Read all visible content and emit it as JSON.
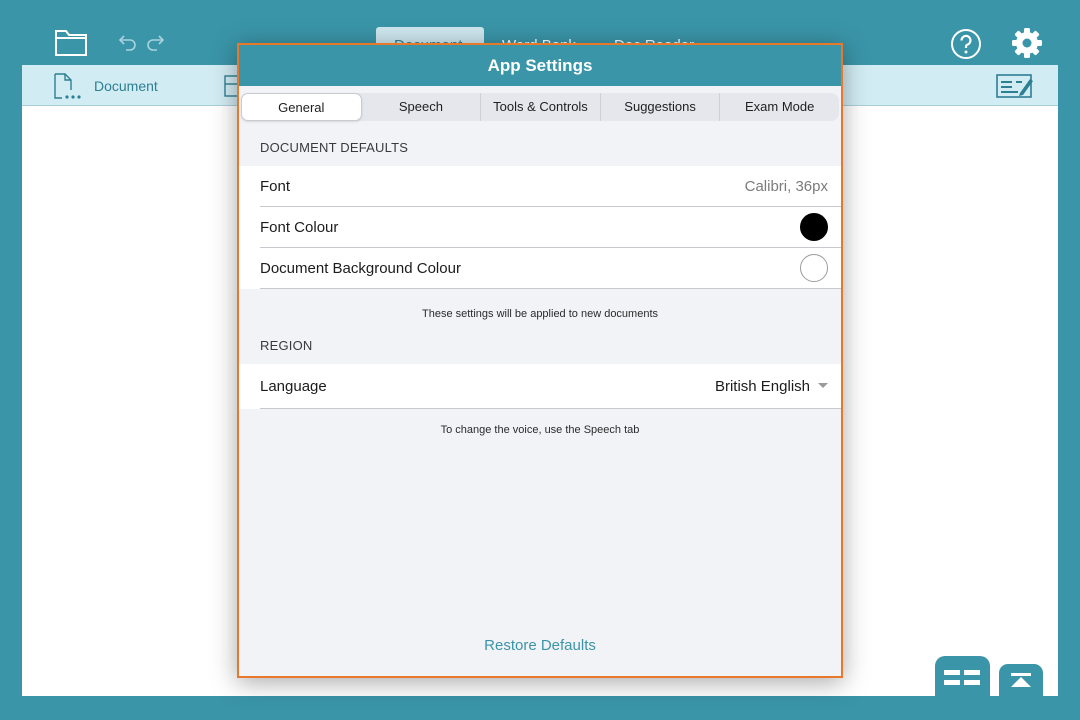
{
  "toolbar": {
    "folder_icon": "folder-icon",
    "undo_icon": "undo-icon",
    "redo_icon": "redo-icon",
    "help_icon": "help-icon",
    "gear_icon": "gear-icon",
    "tabs": [
      "Document",
      "Word Bank",
      "Doc Reader"
    ]
  },
  "subbar": {
    "doc_tab_label": "Document"
  },
  "modal": {
    "title": "App Settings",
    "tabs": [
      "General",
      "Speech",
      "Tools & Controls",
      "Suggestions",
      "Exam Mode"
    ],
    "active_tab": "General",
    "document_defaults": {
      "heading": "DOCUMENT DEFAULTS",
      "font_label": "Font",
      "font_value": "Calibri, 36px",
      "font_colour_label": "Font Colour",
      "font_colour": "#000000",
      "bg_colour_label": "Document Background Colour",
      "bg_colour": "#ffffff",
      "note": "These settings will be applied to new documents"
    },
    "region": {
      "heading": "REGION",
      "language_label": "Language",
      "language_value": "British English",
      "note": "To change the voice, use the Speech tab"
    },
    "restore_label": "Restore Defaults"
  },
  "colors": {
    "brand": "#3a95a8",
    "accent_border": "#e8792b",
    "subbar": "#d2ecf4"
  }
}
